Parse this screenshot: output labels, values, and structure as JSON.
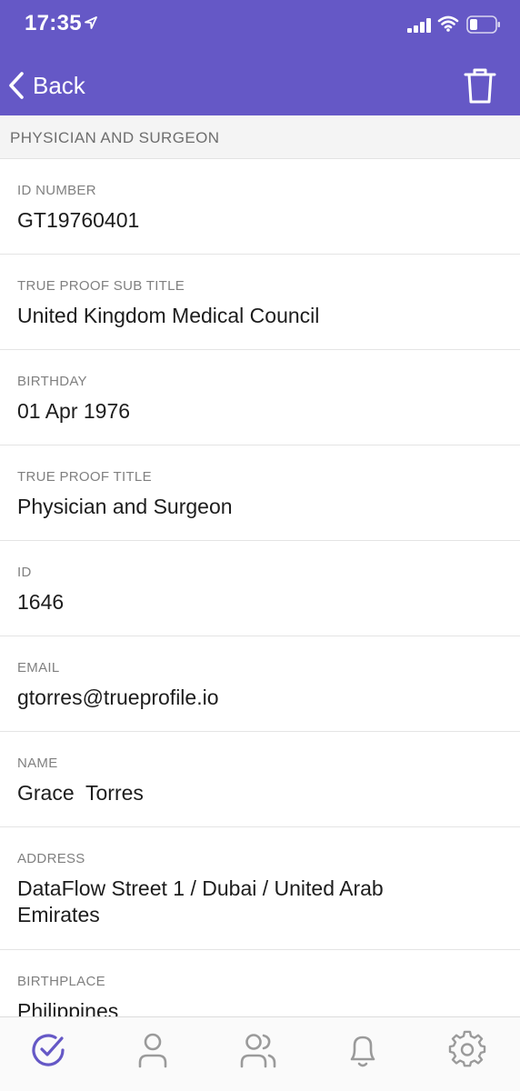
{
  "status_bar": {
    "time": "17:35"
  },
  "nav": {
    "back_label": "Back"
  },
  "section": {
    "title": "PHYSICIAN AND SURGEON"
  },
  "fields": [
    {
      "label": "ID NUMBER",
      "value": "GT19760401"
    },
    {
      "label": "TRUE PROOF SUB TITLE",
      "value": "United Kingdom Medical Council"
    },
    {
      "label": "BIRTHDAY",
      "value": "01 Apr 1976"
    },
    {
      "label": "TRUE PROOF TITLE",
      "value": "Physician and Surgeon"
    },
    {
      "label": "ID",
      "value": "1646"
    },
    {
      "label": "EMAIL",
      "value": "gtorres@trueprofile.io"
    },
    {
      "label": "NAME",
      "value": "Grace  Torres"
    },
    {
      "label": "ADDRESS",
      "value": "DataFlow Street 1 / Dubai / United Arab Emirates"
    },
    {
      "label": "BIRTHPLACE",
      "value": "Philippines"
    }
  ],
  "tabbar": {
    "items": [
      {
        "icon": "check-circle-icon",
        "active": true
      },
      {
        "icon": "user-icon",
        "active": false
      },
      {
        "icon": "users-icon",
        "active": false
      },
      {
        "icon": "bell-icon",
        "active": false
      },
      {
        "icon": "gear-icon",
        "active": false
      }
    ]
  },
  "colors": {
    "header": "#6558c6",
    "active_tab": "#6558c6",
    "inactive_tab": "#9a9a9a"
  }
}
